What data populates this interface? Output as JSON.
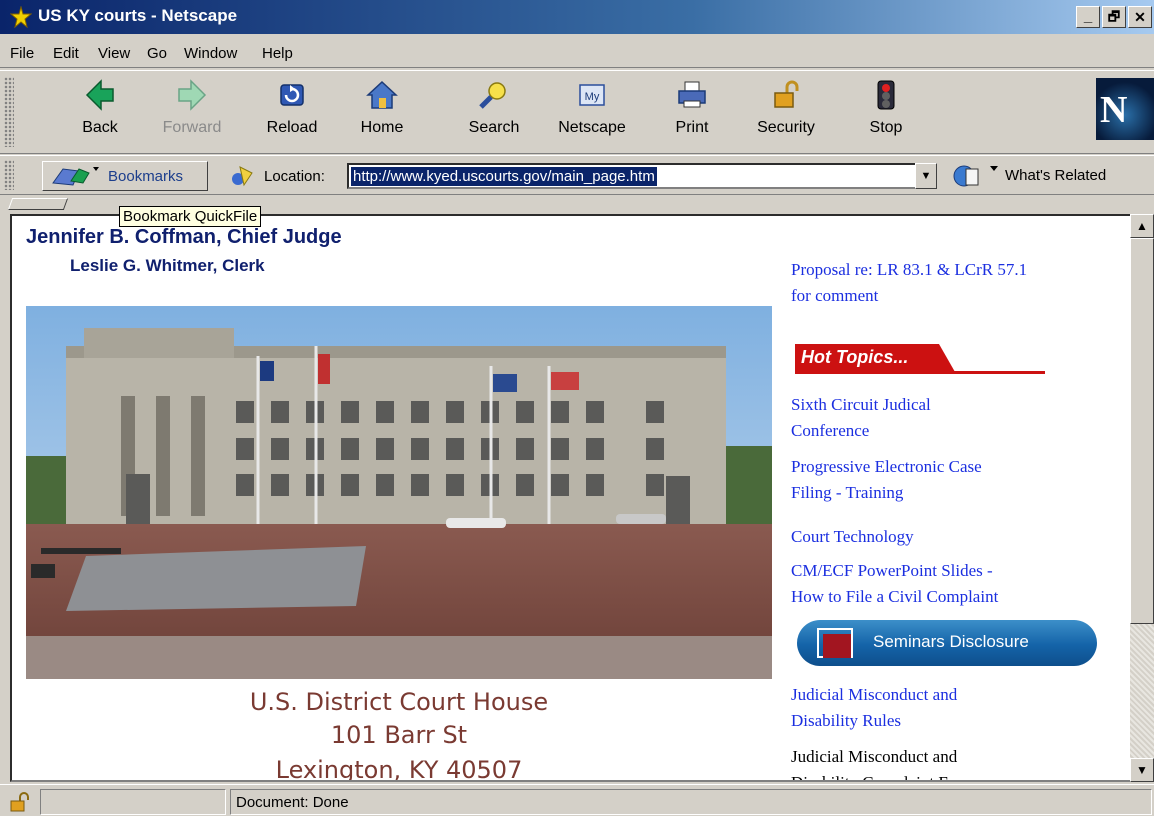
{
  "window": {
    "title": "US KY courts - Netscape",
    "minimize_glyph": "_",
    "maximize_glyph": "🗗",
    "close_glyph": "✕"
  },
  "menu": [
    "File",
    "Edit",
    "View",
    "Go",
    "Window",
    "Help"
  ],
  "toolbar": {
    "buttons": [
      {
        "label": "Back",
        "icon": "back-arrow-icon",
        "enabled": true
      },
      {
        "label": "Forward",
        "icon": "forward-arrow-icon",
        "enabled": false
      },
      {
        "label": "Reload",
        "icon": "reload-icon",
        "enabled": true
      },
      {
        "label": "Home",
        "icon": "home-icon",
        "enabled": true
      },
      {
        "label": "Search",
        "icon": "search-icon",
        "enabled": true
      },
      {
        "label": "Netscape",
        "icon": "my-netscape-icon",
        "badge": "My",
        "enabled": true
      },
      {
        "label": "Print",
        "icon": "printer-icon",
        "enabled": true
      },
      {
        "label": "Security",
        "icon": "padlock-icon",
        "enabled": true
      },
      {
        "label": "Stop",
        "icon": "stoplight-icon",
        "enabled": true
      }
    ],
    "logo_letter": "N"
  },
  "location_bar": {
    "bookmarks_label": "Bookmarks",
    "location_label": "Location:",
    "url": "http://www.kyed.uscourts.gov/main_page.htm",
    "whats_related_label": "What's Related"
  },
  "tooltip": "Bookmark QuickFile",
  "page": {
    "judge": "Jennifer B. Coffman, Chief Judge",
    "clerk": "Leslie G. Whitmer, Clerk",
    "address": [
      "U.S. District Court House",
      "101 Barr St",
      "Lexington, KY 40507"
    ],
    "proposal_link": [
      "Proposal re: LR 83.1 & LCrR 57.1",
      "for comment"
    ],
    "hot_topics_title": "Hot Topics...",
    "links": [
      [
        "Sixth Circuit Judical",
        "Conference"
      ],
      [
        "Progressive Electronic Case",
        "Filing - Training"
      ],
      [
        "Court Technology"
      ],
      [
        "CM/ECF PowerPoint Slides -",
        "How to File a Civil Complaint"
      ]
    ],
    "seminars_label": "Seminars Disclosure",
    "misconduct_link": [
      "Judicial Misconduct and",
      "Disability Rules"
    ],
    "misconduct_form": [
      "Judicial Misconduct and",
      "Disability Complaint Form"
    ]
  },
  "scrollbar": {
    "up_glyph": "▲",
    "down_glyph": "▼"
  },
  "status": {
    "text": "Document: Done"
  },
  "colors": {
    "link": "#1b2fe0",
    "heading": "#10206e",
    "accent_red": "#cc1111",
    "title_bar": "#0a246a"
  }
}
